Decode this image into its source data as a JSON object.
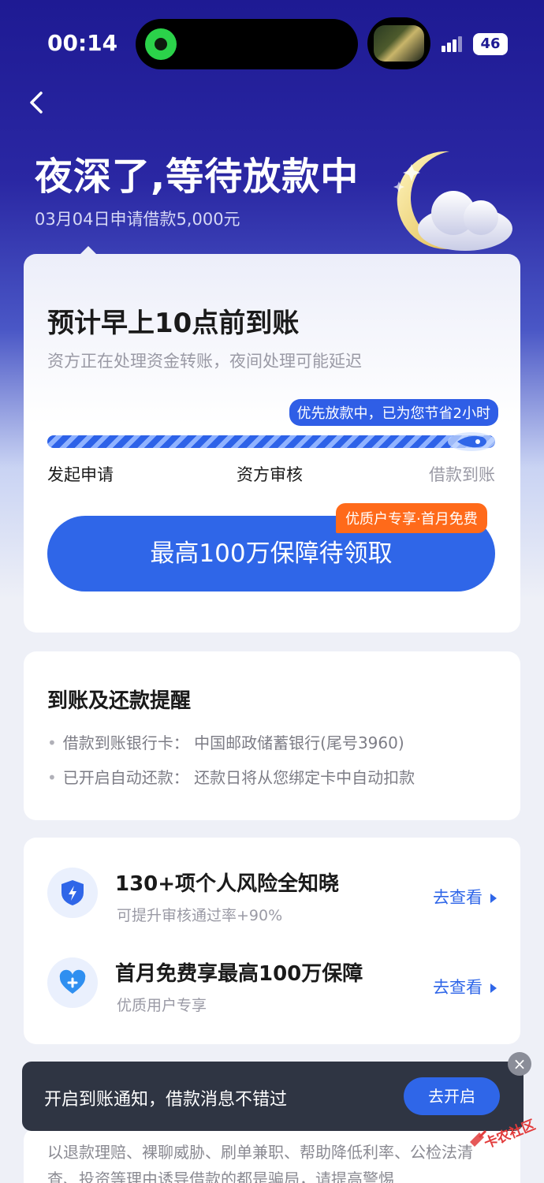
{
  "status_bar": {
    "time": "00:14",
    "battery": "46"
  },
  "header": {
    "title": "夜深了,等待放款中",
    "subtitle": "03月04日申请借款5,000元"
  },
  "status_card": {
    "eta": "预计早上10点前到账",
    "note": "资方正在处理资金转账，夜间处理可能延迟",
    "priority_badge": "优先放款中，已为您节省2小时",
    "progress_percent": 95,
    "steps": [
      "发起申请",
      "资方审核",
      "借款到账"
    ],
    "cta_label": "最高100万保障待领取",
    "cta_tag": "优质户专享·首月免费"
  },
  "reminder_card": {
    "title": "到账及还款提醒",
    "items": [
      "借款到账银行卡：  中国邮政储蓄银行(尾号3960)",
      "已开启自动还款：  还款日将从您绑定卡中自动扣款"
    ]
  },
  "services": [
    {
      "title": "130+项个人风险全知晓",
      "subtitle": "可提升审核通过率+90%",
      "link": "去查看",
      "icon": "shield-bolt-icon"
    },
    {
      "title": "首月免费享最高100万保障",
      "subtitle": "优质用户专享",
      "link": "去查看",
      "icon": "heart-plus-icon"
    }
  ],
  "notice_text": "以退款理赔、裸聊威胁、刷单兼职、帮助降低利率、公检法清查、投资等理由诱导借款的都是骗局，请提高警惕",
  "toast": {
    "text": "开启到账通知，借款消息不错过",
    "button": "去开启",
    "close": "×"
  },
  "watermark": {
    "text": "卡农社区"
  },
  "colors": {
    "primary": "#2f66e8",
    "hero": "#1e1a93",
    "tag_orange": "#ff6a1a"
  }
}
